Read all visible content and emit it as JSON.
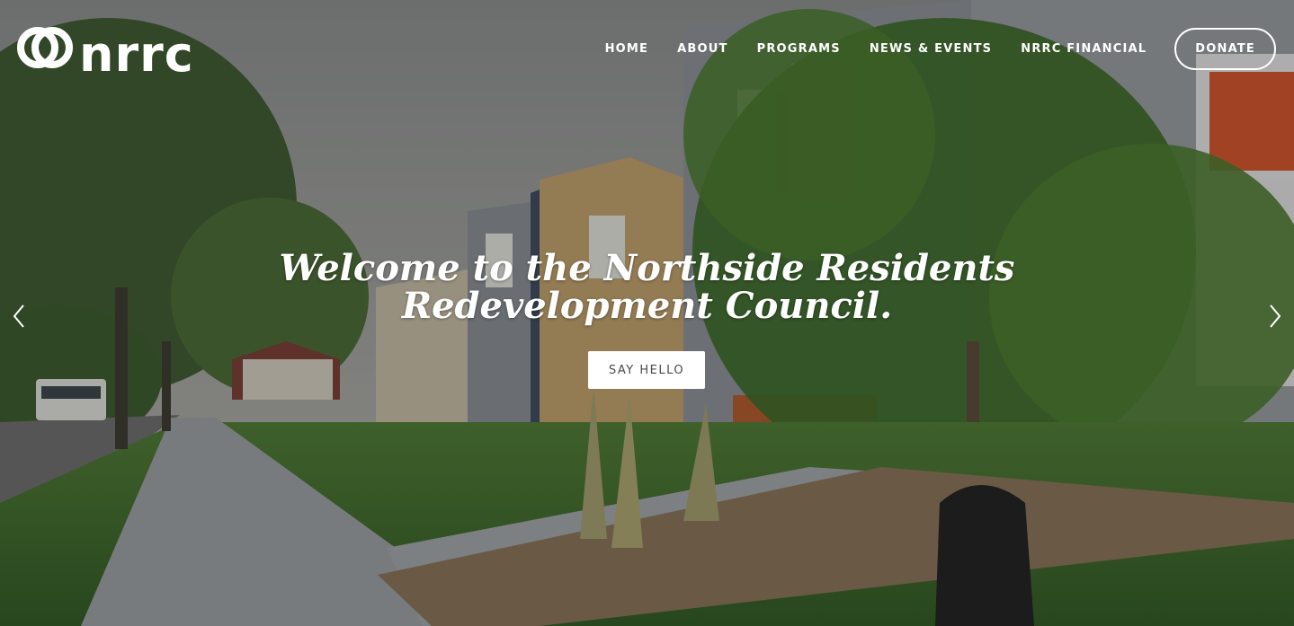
{
  "logo": {
    "text": "nrrc",
    "icon": "linked-rings-icon"
  },
  "nav": {
    "items": [
      "HOME",
      "ABOUT",
      "PROGRAMS",
      "NEWS & EVENTS",
      "NRRC FINANCIAL"
    ],
    "donate_label": "DONATE"
  },
  "hero": {
    "headline_line1": "Welcome to the Northside Residents",
    "headline_line2": "Redevelopment Council.",
    "cta_label": "SAY HELLO",
    "prev_icon": "chevron-left-icon",
    "next_icon": "chevron-right-icon"
  },
  "colors": {
    "text": "#ffffff",
    "cta_bg": "#ffffff",
    "cta_text": "#4a4a4a",
    "sky": "#9aa0a0",
    "grass": "#3f6f2b",
    "siding_gray": "#8b8f95",
    "accent_orange": "#d9542a"
  }
}
